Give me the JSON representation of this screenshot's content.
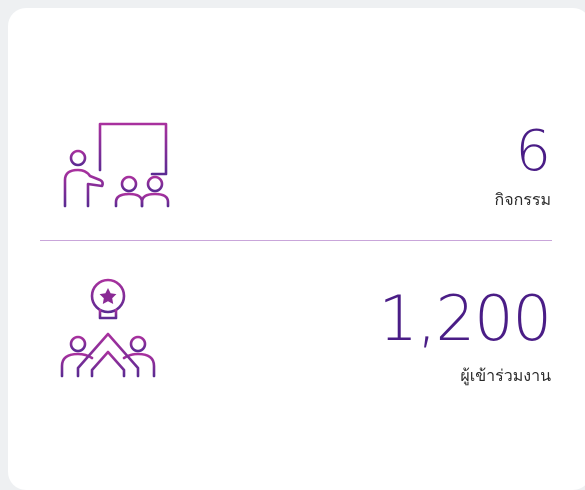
{
  "colors": {
    "accent": "#4a1d86",
    "icon_gradient_start": "#a8319e",
    "icon_gradient_end": "#5b2a92",
    "divider": "#c9a6da"
  },
  "stats": [
    {
      "value": "6",
      "label": "กิจกรรม",
      "icon": "presentation-teacher-icon"
    },
    {
      "value": "1,200",
      "label": "ผู้เข้าร่วมงาน",
      "icon": "idea-high-five-icon"
    }
  ]
}
